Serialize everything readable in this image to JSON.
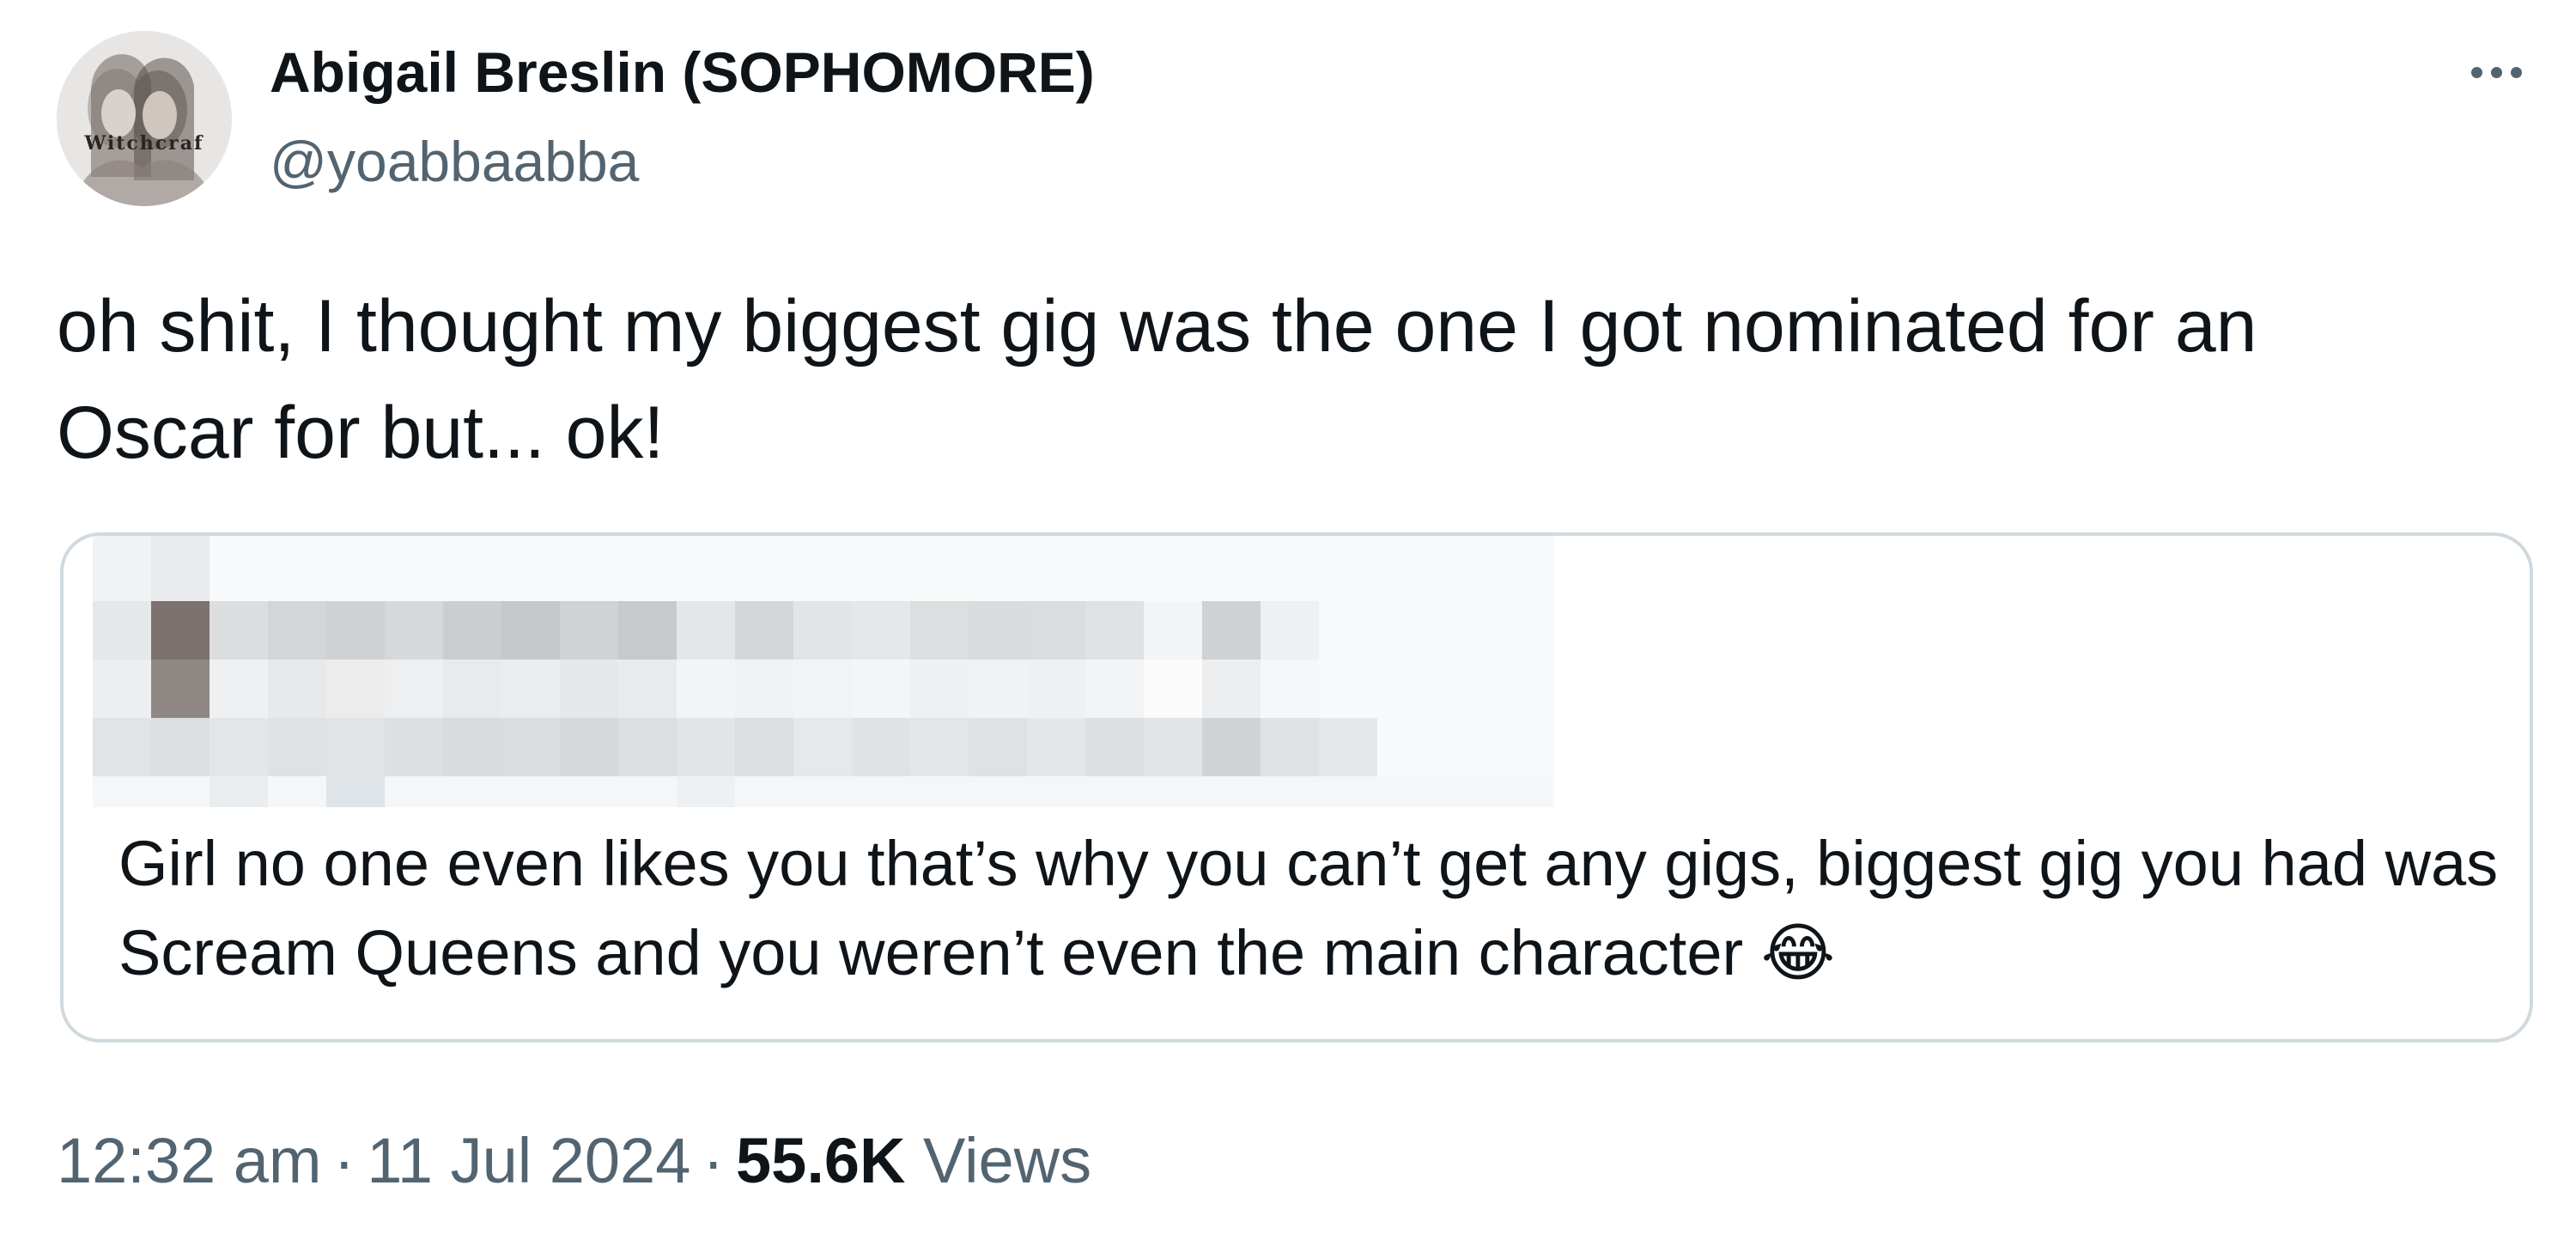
{
  "author": {
    "display_name": "Abigail Breslin (SOPHOMORE)",
    "handle": "@yoabbaabba",
    "avatar_overlay_text": "Witchcraf"
  },
  "menu": {
    "icon": "more-horizontal-icon"
  },
  "tweet": {
    "text": "oh shit, I thought my biggest gig was the one I got nominated for an Oscar for but... ok!"
  },
  "quote": {
    "header_redacted": true,
    "text": "Girl no one even likes you that’s why you can’t get any gigs, biggest gig you had was Scream Queens and you weren’t even the main character 😂"
  },
  "meta": {
    "time": "12:32 am",
    "separator": "·",
    "date": "11 Jul 2024",
    "views_count": "55.6K",
    "views_label": "Views"
  },
  "colors": {
    "text_primary": "#0f1419",
    "text_secondary": "#536471",
    "border": "#cfd9de"
  }
}
